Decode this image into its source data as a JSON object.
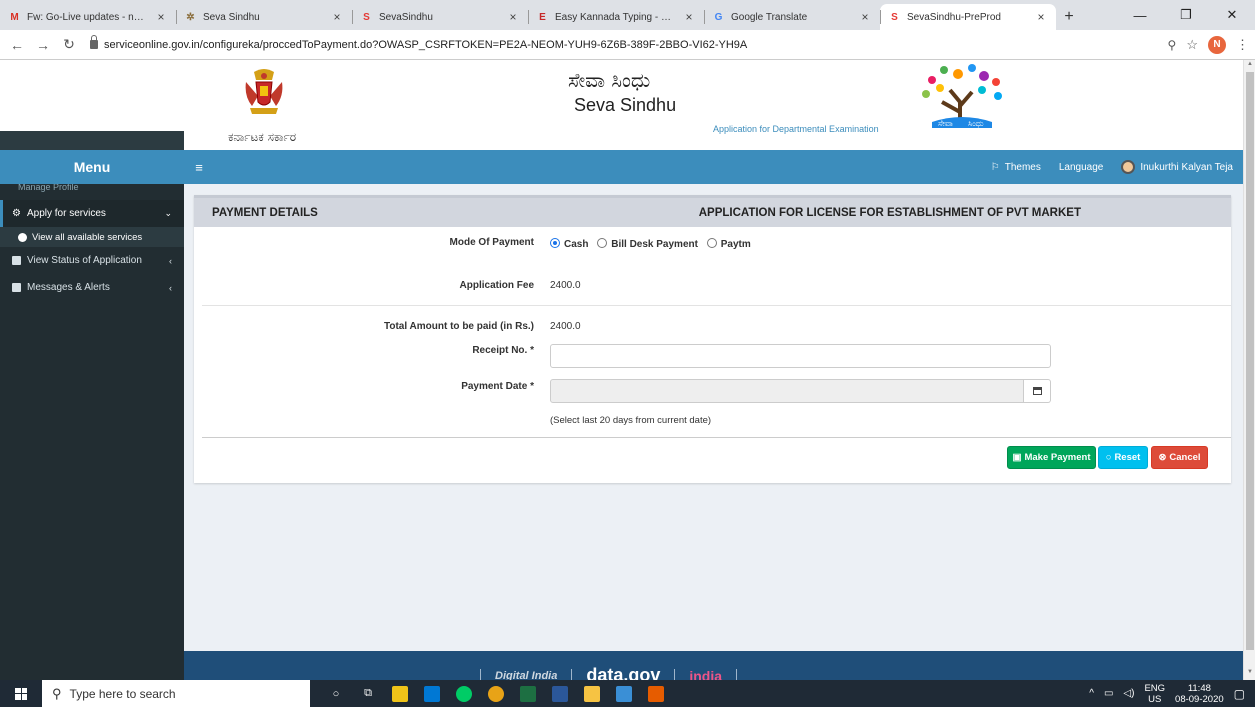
{
  "browser": {
    "tabs": [
      {
        "title": "Fw: Go-Live updates - nageshn",
        "favicon": "M",
        "favcolor": "#d93025",
        "active": false
      },
      {
        "title": "Seva Sindhu",
        "favicon": "✲",
        "favcolor": "#8a6d3b",
        "active": false
      },
      {
        "title": "SevaSindhu",
        "favicon": "S",
        "favcolor": "#e53935",
        "active": false
      },
      {
        "title": "Easy Kannada Typing - English",
        "favicon": "E",
        "favcolor": "#c62828",
        "active": false
      },
      {
        "title": "Google Translate",
        "favicon": "G",
        "favcolor": "#4285f4",
        "active": false
      },
      {
        "title": "SevaSindhu-PreProd",
        "favicon": "S",
        "favcolor": "#e53935",
        "active": true
      }
    ],
    "url": "serviceonline.gov.in/configureka/proccedToPayment.do?OWASP_CSRFTOKEN=PE2A-NEOM-YUH9-6Z6B-389F-2BBO-VI62-YH9A",
    "profile_initial": "N"
  },
  "header": {
    "emblem_caption": "ಕರ್ನಾಟಕ ಸರ್ಕಾರ",
    "brand_kannada": "ಸೇವಾ ಸಿಂಧು",
    "brand_english": "Seva Sindhu",
    "subtitle": "Application for Departmental Examination"
  },
  "navbar": {
    "menu_label": "Menu",
    "themes": "Themes",
    "language": "Language",
    "user": "Inukurthi Kalyan Teja"
  },
  "sidebar": {
    "cut_item": "Manage Profile",
    "items": [
      {
        "label": "Apply for services",
        "arrow": "⌄"
      },
      {
        "label": "View all available services"
      },
      {
        "label": "View Status of Application",
        "arrow": "‹"
      },
      {
        "label": "Messages & Alerts",
        "arrow": "‹"
      }
    ]
  },
  "panel": {
    "left_title": "PAYMENT DETAILS",
    "right_title": "APPLICATION FOR LICENSE FOR ESTABLISHMENT OF PVT MARKET",
    "mode_label": "Mode Of Payment",
    "mode_options": [
      "Cash",
      "Bill Desk Payment",
      "Paytm"
    ],
    "mode_selected": "Cash",
    "fee_label": "Application Fee",
    "fee_value": "2400.0",
    "total_label": "Total Amount to be paid (in Rs.)",
    "total_value": "2400.0",
    "receipt_label": "Receipt No. *",
    "receipt_value": "",
    "date_label": "Payment Date *",
    "date_value": "",
    "date_hint": "(Select last 20 days from current date)",
    "buttons": {
      "pay": "Make Payment",
      "reset": "Reset",
      "cancel": "Cancel"
    }
  },
  "taskbar": {
    "search_placeholder": "Type here to search",
    "lang_top": "ENG",
    "lang_bottom": "US",
    "time": "11:48",
    "date": "08-09-2020"
  },
  "footer": {
    "logo_texts": [
      "Digital India",
      "data.gov",
      "india"
    ]
  }
}
